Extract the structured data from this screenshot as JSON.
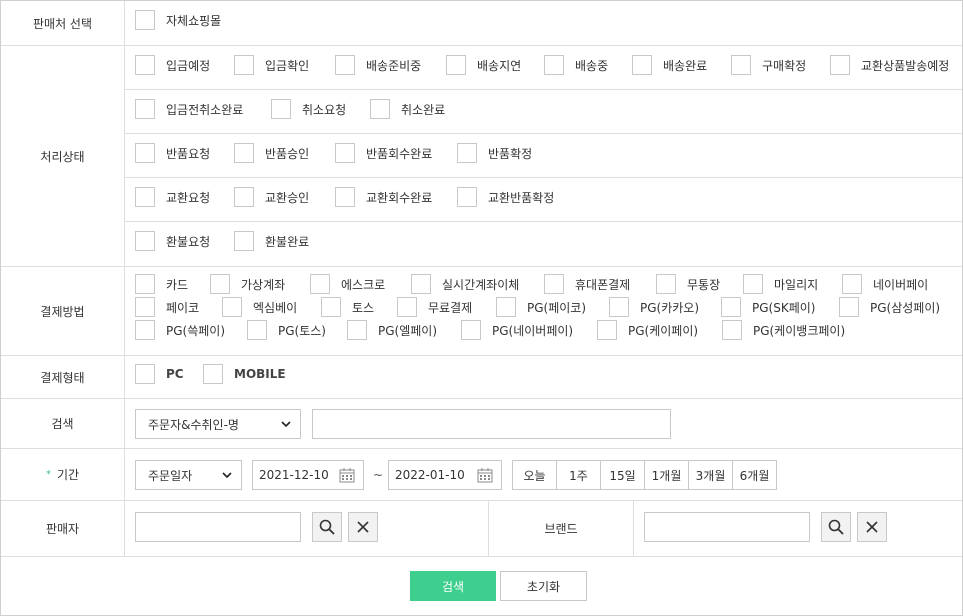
{
  "seller_select": {
    "label": "판매처 선택",
    "options": [
      "자체쇼핑몰"
    ]
  },
  "process_status": {
    "label": "처리상태",
    "lines": [
      [
        "입금예정",
        "입금확인",
        "배송준비중",
        "배송지연",
        "배송중",
        "배송완료",
        "구매확정",
        "교환상품발송예정"
      ],
      [
        "입금전취소완료",
        "취소요청",
        "취소완료"
      ],
      [
        "반품요청",
        "반품승인",
        "반품회수완료",
        "반품확정"
      ],
      [
        "교환요청",
        "교환승인",
        "교환회수완료",
        "교환반품확정"
      ],
      [
        "환불요청",
        "환불완료"
      ]
    ]
  },
  "payment_method": {
    "label": "결제방법",
    "lines": [
      [
        "카드",
        "가상계좌",
        "에스크로",
        "실시간계좌이체",
        "휴대폰결제",
        "무통장",
        "마일리지",
        "네이버페이"
      ],
      [
        "페이코",
        "엑심베이",
        "토스",
        "무료결제",
        "PG(페이코)",
        "PG(카카오)",
        "PG(SK페이)",
        "PG(삼성페이)"
      ],
      [
        "PG(쓱페이)",
        "PG(토스)",
        "PG(엘페이)",
        "PG(네이버페이)",
        "PG(케이페이)",
        "PG(케이뱅크페이)"
      ]
    ]
  },
  "payment_type": {
    "label": "결제형태",
    "options": [
      "PC",
      "MOBILE"
    ]
  },
  "search": {
    "label": "검색",
    "select_value": "주문자&수취인-명",
    "input_value": ""
  },
  "period": {
    "required_mark": "*",
    "label": "기간",
    "select_value": "주문일자",
    "start_date": "2021-12-10",
    "separator": "~",
    "end_date": "2022-01-10",
    "quick": [
      "오늘",
      "1주",
      "15일",
      "1개월",
      "3개월",
      "6개월"
    ]
  },
  "seller": {
    "label": "판매자",
    "input_value": "",
    "brand_label": "브랜드",
    "brand_input_value": ""
  },
  "actions": {
    "search_label": "검색",
    "reset_label": "초기화"
  },
  "icons": {
    "search": "search-icon",
    "clear": "close-icon",
    "calendar": "calendar-icon",
    "dropdown": "chevron-down-icon"
  },
  "colors": {
    "primary": "#3ecf8e",
    "required": "#3cc08a",
    "border": "#c8c8c8"
  }
}
